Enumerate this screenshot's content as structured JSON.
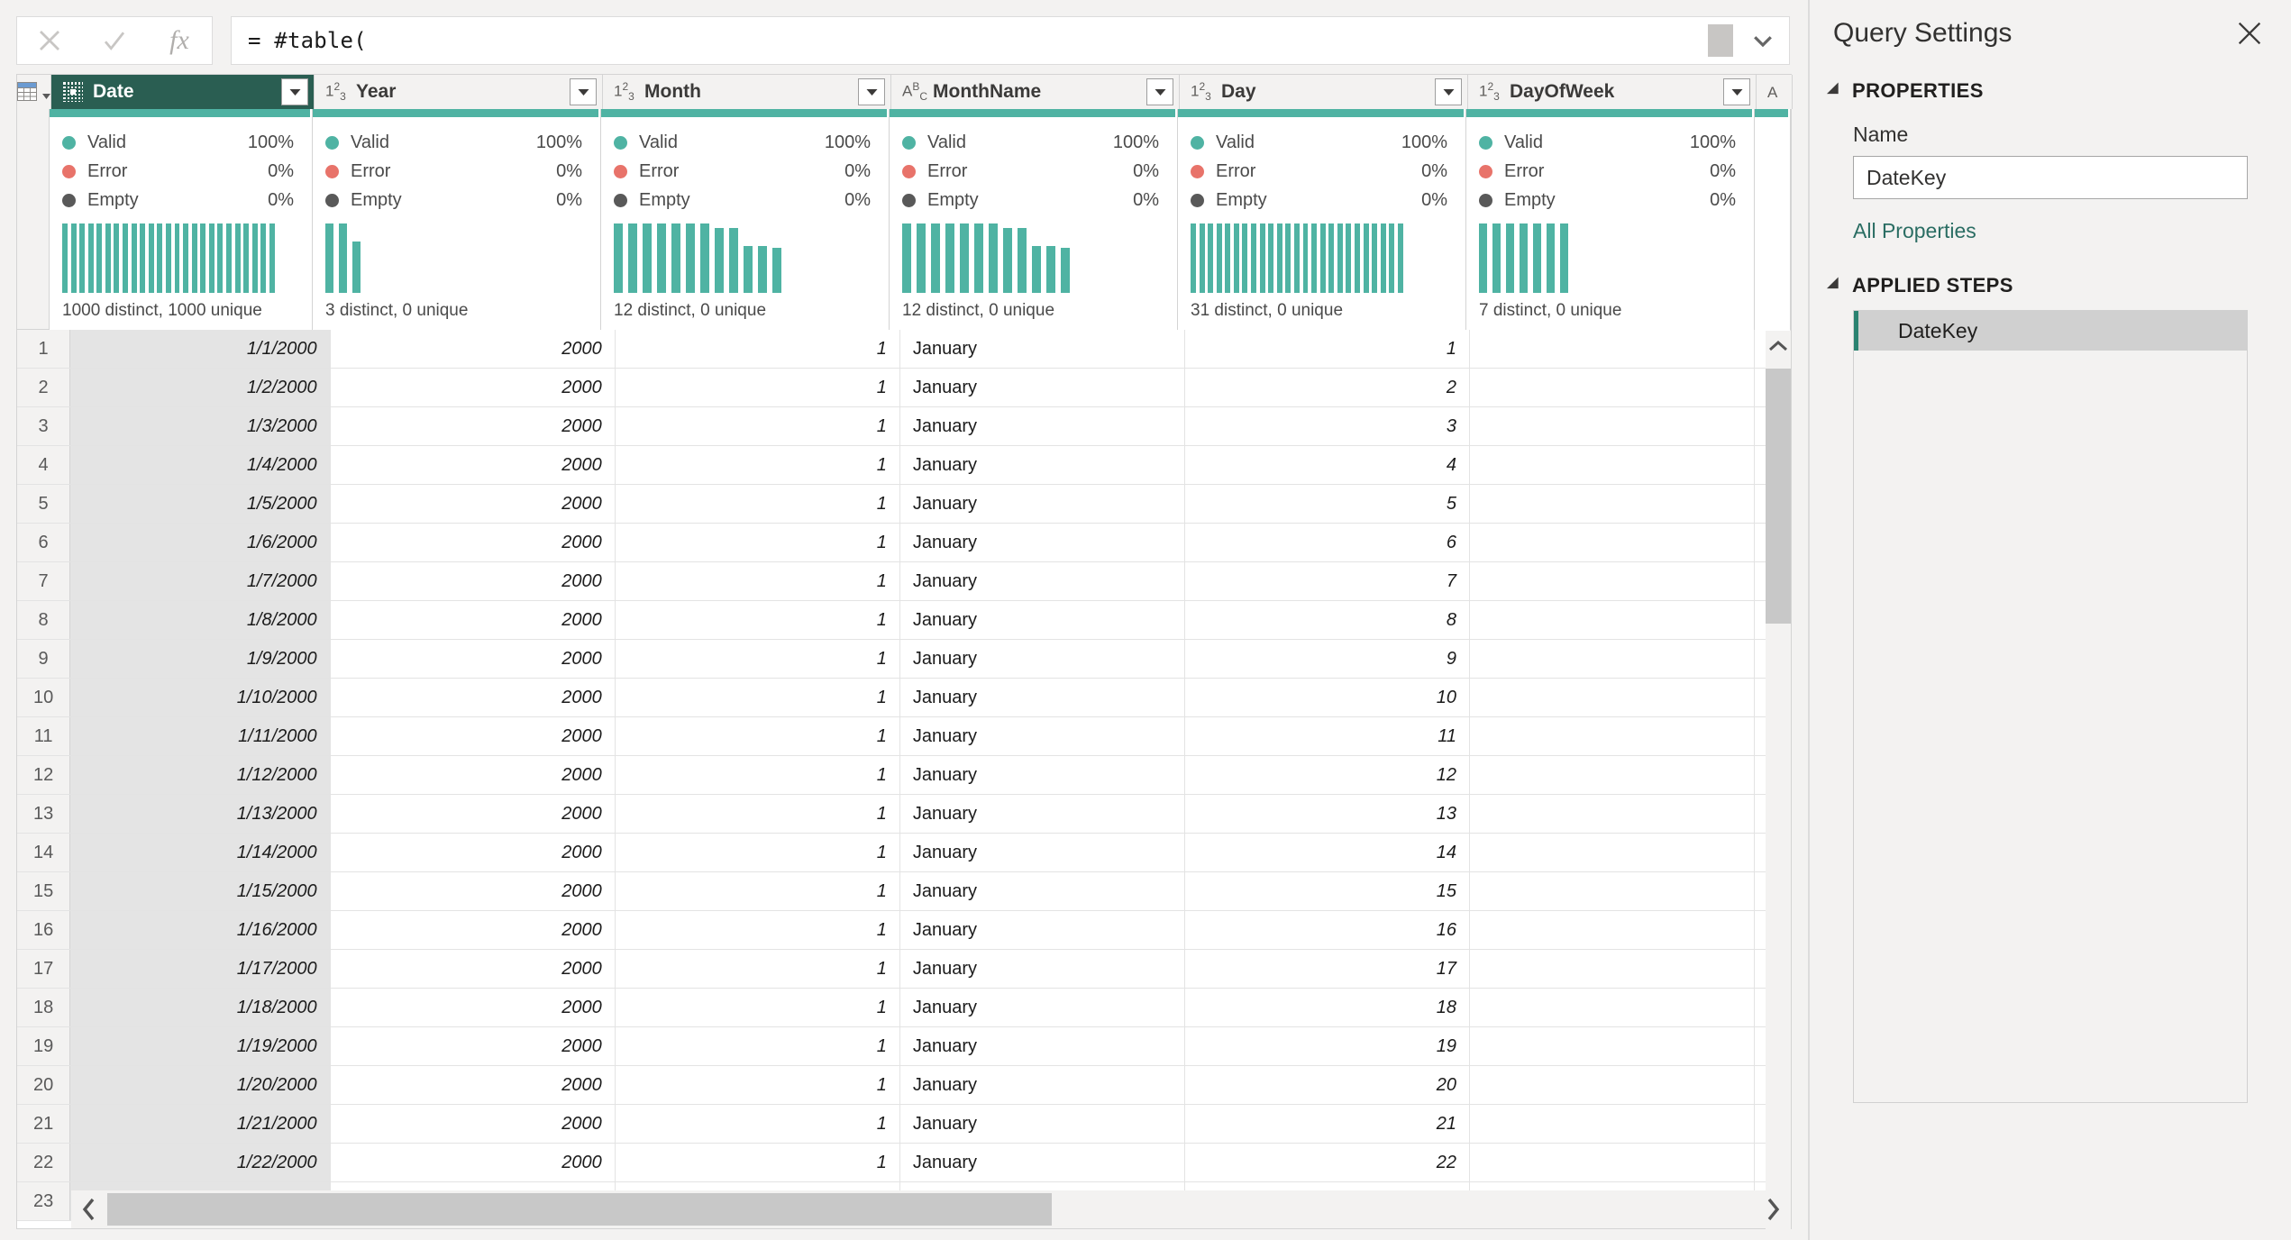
{
  "formula_bar": {
    "cancel_icon": "close-icon",
    "accept_icon": "check-icon",
    "fx_icon": "fx-icon",
    "formula": "= #table(",
    "expand_icon": "chevron-down-icon"
  },
  "grid": {
    "corner_icon": "select-all-table-icon",
    "columns": [
      {
        "name": "Date",
        "type": "date",
        "type_icon": "calendar-icon",
        "selected": true,
        "align": "right",
        "italic": true,
        "quality": {
          "valid": "100%",
          "error": "0%",
          "empty": "0%"
        },
        "distinct": "1000 distinct, 1000 unique",
        "histogram": [
          100,
          100,
          100,
          100,
          100,
          100,
          100,
          100,
          100,
          100,
          100,
          100,
          100,
          100,
          100,
          100,
          100,
          100,
          100,
          100,
          100,
          100,
          100,
          100,
          100
        ]
      },
      {
        "name": "Year",
        "type": "number",
        "type_icon": "123-icon",
        "selected": false,
        "align": "right",
        "italic": true,
        "quality": {
          "valid": "100%",
          "error": "0%",
          "empty": "0%"
        },
        "distinct": "3 distinct, 0 unique",
        "histogram": [
          100,
          100,
          74
        ]
      },
      {
        "name": "Month",
        "type": "number",
        "type_icon": "123-icon",
        "selected": false,
        "align": "right",
        "italic": true,
        "quality": {
          "valid": "100%",
          "error": "0%",
          "empty": "0%"
        },
        "distinct": "12 distinct, 0 unique",
        "histogram": [
          100,
          100,
          100,
          100,
          100,
          100,
          100,
          93,
          93,
          68,
          68,
          65
        ]
      },
      {
        "name": "MonthName",
        "type": "text",
        "type_icon": "abc-icon",
        "selected": false,
        "align": "left",
        "italic": false,
        "quality": {
          "valid": "100%",
          "error": "0%",
          "empty": "0%"
        },
        "distinct": "12 distinct, 0 unique",
        "histogram": [
          100,
          100,
          100,
          100,
          100,
          100,
          100,
          93,
          93,
          68,
          68,
          65
        ]
      },
      {
        "name": "Day",
        "type": "number",
        "type_icon": "123-icon",
        "selected": false,
        "align": "right",
        "italic": true,
        "quality": {
          "valid": "100%",
          "error": "0%",
          "empty": "0%"
        },
        "distinct": "31 distinct, 0 unique",
        "histogram": [
          100,
          100,
          100,
          100,
          100,
          100,
          100,
          100,
          100,
          100,
          100,
          100,
          100,
          100,
          100,
          100,
          100,
          100,
          100,
          100,
          100,
          100,
          100,
          100,
          100
        ]
      },
      {
        "name": "DayOfWeek",
        "type": "number",
        "type_icon": "123-icon",
        "selected": false,
        "align": "right",
        "italic": true,
        "quality": {
          "valid": "100%",
          "error": "0%",
          "empty": "0%"
        },
        "distinct": "7 distinct, 0 unique",
        "histogram": [
          100,
          100,
          100,
          100,
          100,
          100,
          100
        ]
      }
    ],
    "quality_labels": {
      "valid": "Valid",
      "error": "Error",
      "empty": "Empty"
    },
    "rows": [
      {
        "n": "1",
        "Date": "1/1/2000",
        "Year": "2000",
        "Month": "1",
        "MonthName": "January",
        "Day": "1",
        "DayOfWeek": ""
      },
      {
        "n": "2",
        "Date": "1/2/2000",
        "Year": "2000",
        "Month": "1",
        "MonthName": "January",
        "Day": "2",
        "DayOfWeek": ""
      },
      {
        "n": "3",
        "Date": "1/3/2000",
        "Year": "2000",
        "Month": "1",
        "MonthName": "January",
        "Day": "3",
        "DayOfWeek": ""
      },
      {
        "n": "4",
        "Date": "1/4/2000",
        "Year": "2000",
        "Month": "1",
        "MonthName": "January",
        "Day": "4",
        "DayOfWeek": ""
      },
      {
        "n": "5",
        "Date": "1/5/2000",
        "Year": "2000",
        "Month": "1",
        "MonthName": "January",
        "Day": "5",
        "DayOfWeek": ""
      },
      {
        "n": "6",
        "Date": "1/6/2000",
        "Year": "2000",
        "Month": "1",
        "MonthName": "January",
        "Day": "6",
        "DayOfWeek": ""
      },
      {
        "n": "7",
        "Date": "1/7/2000",
        "Year": "2000",
        "Month": "1",
        "MonthName": "January",
        "Day": "7",
        "DayOfWeek": ""
      },
      {
        "n": "8",
        "Date": "1/8/2000",
        "Year": "2000",
        "Month": "1",
        "MonthName": "January",
        "Day": "8",
        "DayOfWeek": ""
      },
      {
        "n": "9",
        "Date": "1/9/2000",
        "Year": "2000",
        "Month": "1",
        "MonthName": "January",
        "Day": "9",
        "DayOfWeek": ""
      },
      {
        "n": "10",
        "Date": "1/10/2000",
        "Year": "2000",
        "Month": "1",
        "MonthName": "January",
        "Day": "10",
        "DayOfWeek": ""
      },
      {
        "n": "11",
        "Date": "1/11/2000",
        "Year": "2000",
        "Month": "1",
        "MonthName": "January",
        "Day": "11",
        "DayOfWeek": ""
      },
      {
        "n": "12",
        "Date": "1/12/2000",
        "Year": "2000",
        "Month": "1",
        "MonthName": "January",
        "Day": "12",
        "DayOfWeek": ""
      },
      {
        "n": "13",
        "Date": "1/13/2000",
        "Year": "2000",
        "Month": "1",
        "MonthName": "January",
        "Day": "13",
        "DayOfWeek": ""
      },
      {
        "n": "14",
        "Date": "1/14/2000",
        "Year": "2000",
        "Month": "1",
        "MonthName": "January",
        "Day": "14",
        "DayOfWeek": ""
      },
      {
        "n": "15",
        "Date": "1/15/2000",
        "Year": "2000",
        "Month": "1",
        "MonthName": "January",
        "Day": "15",
        "DayOfWeek": ""
      },
      {
        "n": "16",
        "Date": "1/16/2000",
        "Year": "2000",
        "Month": "1",
        "MonthName": "January",
        "Day": "16",
        "DayOfWeek": ""
      },
      {
        "n": "17",
        "Date": "1/17/2000",
        "Year": "2000",
        "Month": "1",
        "MonthName": "January",
        "Day": "17",
        "DayOfWeek": ""
      },
      {
        "n": "18",
        "Date": "1/18/2000",
        "Year": "2000",
        "Month": "1",
        "MonthName": "January",
        "Day": "18",
        "DayOfWeek": ""
      },
      {
        "n": "19",
        "Date": "1/19/2000",
        "Year": "2000",
        "Month": "1",
        "MonthName": "January",
        "Day": "19",
        "DayOfWeek": ""
      },
      {
        "n": "20",
        "Date": "1/20/2000",
        "Year": "2000",
        "Month": "1",
        "MonthName": "January",
        "Day": "20",
        "DayOfWeek": ""
      },
      {
        "n": "21",
        "Date": "1/21/2000",
        "Year": "2000",
        "Month": "1",
        "MonthName": "January",
        "Day": "21",
        "DayOfWeek": ""
      },
      {
        "n": "22",
        "Date": "1/22/2000",
        "Year": "2000",
        "Month": "1",
        "MonthName": "January",
        "Day": "22",
        "DayOfWeek": ""
      },
      {
        "n": "23",
        "Date": "",
        "Year": "",
        "Month": "",
        "MonthName": "",
        "Day": "",
        "DayOfWeek": ""
      }
    ]
  },
  "query_settings": {
    "title": "Query Settings",
    "close_icon": "close-icon",
    "properties_section": "PROPERTIES",
    "name_label": "Name",
    "name_value": "DateKey",
    "all_properties_link": "All Properties",
    "applied_steps_section": "APPLIED STEPS",
    "steps": [
      {
        "label": "DateKey",
        "selected": true
      }
    ]
  },
  "colors": {
    "accent_teal": "#4fb3a3",
    "header_selected": "#2a5e52",
    "error_red": "#e8736a",
    "empty_gray": "#595959",
    "link_teal": "#2a6d63",
    "chrome_gray": "#f3f2f1"
  }
}
